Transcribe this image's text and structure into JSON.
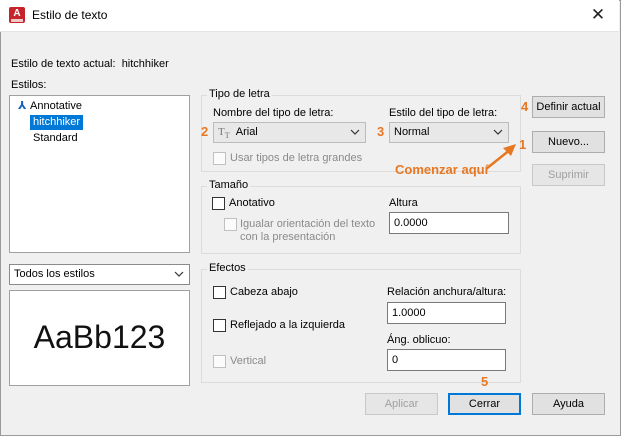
{
  "window": {
    "title": "Estilo de texto",
    "app_icon_letter": "A",
    "close_glyph": "✕"
  },
  "current_style": {
    "label": "Estilo de texto actual:",
    "value": "hitchhiker"
  },
  "styles": {
    "label": "Estilos:",
    "items": [
      {
        "label": "Annotative",
        "icon": "annotative-icon",
        "selected": false
      },
      {
        "label": "hitchhiker",
        "selected": true
      },
      {
        "label": "Standard",
        "selected": false
      }
    ]
  },
  "style_filter": {
    "value": "Todos los estilos"
  },
  "preview": {
    "text": "AaBb123"
  },
  "font": {
    "group_title": "Tipo de letra",
    "name_label": "Nombre del tipo de letra:",
    "name_value": "Arial",
    "name_icon": "truetype-font-icon",
    "style_label": "Estilo del tipo de letra:",
    "style_value": "Normal",
    "bigfont_label": "Usar tipos de letra grandes"
  },
  "size": {
    "group_title": "Tamaño",
    "annotative_label": "Anotativo",
    "match_orientation_label_1": "Igualar orientación del texto",
    "match_orientation_label_2": "con la presentación",
    "height_label": "Altura",
    "height_value": "0.0000"
  },
  "effects": {
    "group_title": "Efectos",
    "upside_down_label": "Cabeza abajo",
    "backwards_label": "Reflejado a la izquierda",
    "vertical_label": "Vertical",
    "width_factor_label": "Relación anchura/altura:",
    "width_factor_value": "1.0000",
    "oblique_label": "Áng. oblicuo:",
    "oblique_value": "0"
  },
  "buttons": {
    "set_current": "Definir actual",
    "new": "Nuevo...",
    "delete": "Suprimir",
    "apply": "Aplicar",
    "close": "Cerrar",
    "help": "Ayuda"
  },
  "annotations": {
    "step1": "1",
    "step2": "2",
    "step3": "3",
    "step4": "4",
    "step5": "5",
    "start_here": "Comenzar aquí",
    "color": "#e87722"
  },
  "colors": {
    "selection": "#0078d7",
    "dialog_bg": "#f0f0f0",
    "app_icon": "#c5252a"
  }
}
